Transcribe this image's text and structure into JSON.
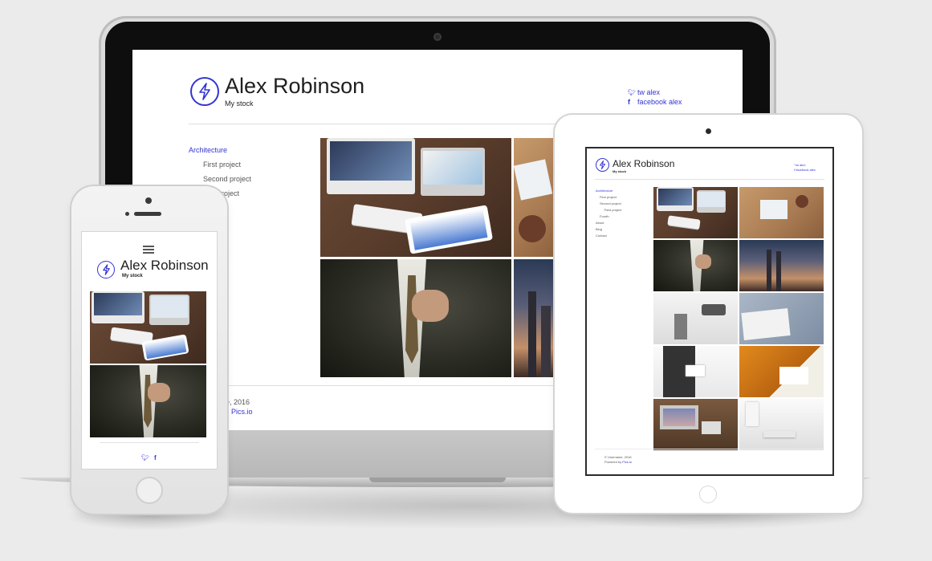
{
  "site": {
    "title": "Alex Robinson",
    "subtitle": "My stock",
    "social": {
      "twitter": "tw alex",
      "facebook": "facebook alex",
      "twitter_icon": "twitter-icon",
      "facebook_icon": "facebook-icon"
    },
    "footer": {
      "copyright_fragment": "e, 2016",
      "powered_link_fragment": "Pics.io"
    }
  },
  "laptop_nav": {
    "active": "Architecture",
    "items": [
      "First project",
      "Second project",
      "project"
    ]
  },
  "tablet_site": {
    "title": "Alex Robinson",
    "subtitle": "My stock",
    "twitter": "tw alex",
    "facebook": "facebook alex",
    "nav_active": "Architecture",
    "nav_items": [
      "First project",
      "Second project",
      "Third project",
      "Fourth",
      "About",
      "Blog",
      "Contact"
    ],
    "footer_copyright": "© Username, 2016",
    "footer_powered_prefix": "Powered by ",
    "footer_powered_link": "Pics.io"
  },
  "phone_site": {
    "title": "Alex Robinson",
    "subtitle": "My stock",
    "menu_icon": "hamburger-menu-icon"
  },
  "colors": {
    "accent": "#3434d6",
    "background": "#ebebeb",
    "text": "#1f1f1f"
  }
}
